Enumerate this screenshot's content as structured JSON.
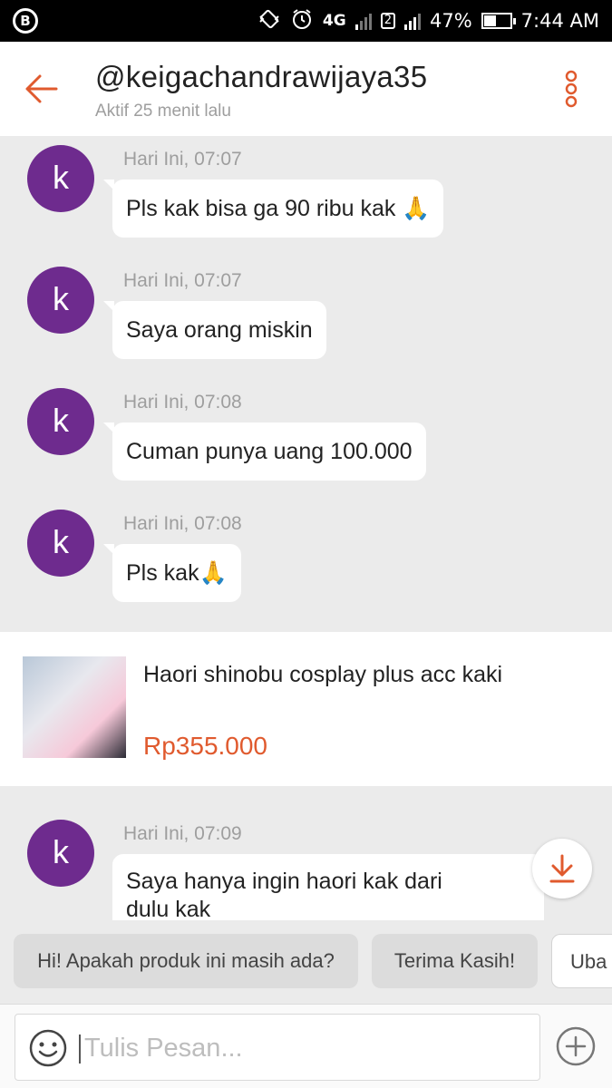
{
  "status_bar": {
    "app_badge": "B",
    "network": "4G",
    "sim_slot": "2",
    "battery": "47%",
    "battery_level": 0.47,
    "time": "7:44 AM"
  },
  "header": {
    "title": "@keigachandrawijaya35",
    "subtitle": "Aktif 25 menit lalu"
  },
  "messages": [
    {
      "avatar": "k",
      "time": "Hari Ini, 07:07",
      "text": "Pls kak bisa ga 90 ribu kak 🙏"
    },
    {
      "avatar": "k",
      "time": "Hari Ini, 07:07",
      "text": "Saya orang miskin"
    },
    {
      "avatar": "k",
      "time": "Hari Ini, 07:08",
      "text": "Cuman punya uang 100.000"
    },
    {
      "avatar": "k",
      "time": "Hari Ini, 07:08",
      "text": "Pls kak🙏"
    },
    {
      "avatar": "k",
      "time": "Hari Ini, 07:09",
      "text_line1": "Saya hanya ingin haori kak dari",
      "text_line2": "dulu kak"
    }
  ],
  "product": {
    "name": "Haori shinobu cosplay plus acc kaki",
    "price": "Rp355.000"
  },
  "quick_replies": [
    "Hi! Apakah produk ini masih ada?",
    "Terima Kasih!",
    "Uba"
  ],
  "composer": {
    "placeholder": "Tulis Pesan..."
  },
  "colors": {
    "accent": "#e05a2e",
    "avatar": "#6e2b8e",
    "background": "#ebebeb"
  },
  "icons": [
    "back-arrow-icon",
    "more-vert-icon",
    "download-icon",
    "smile-icon",
    "plus-circle-icon",
    "alarm-icon",
    "vibrate-icon"
  ]
}
